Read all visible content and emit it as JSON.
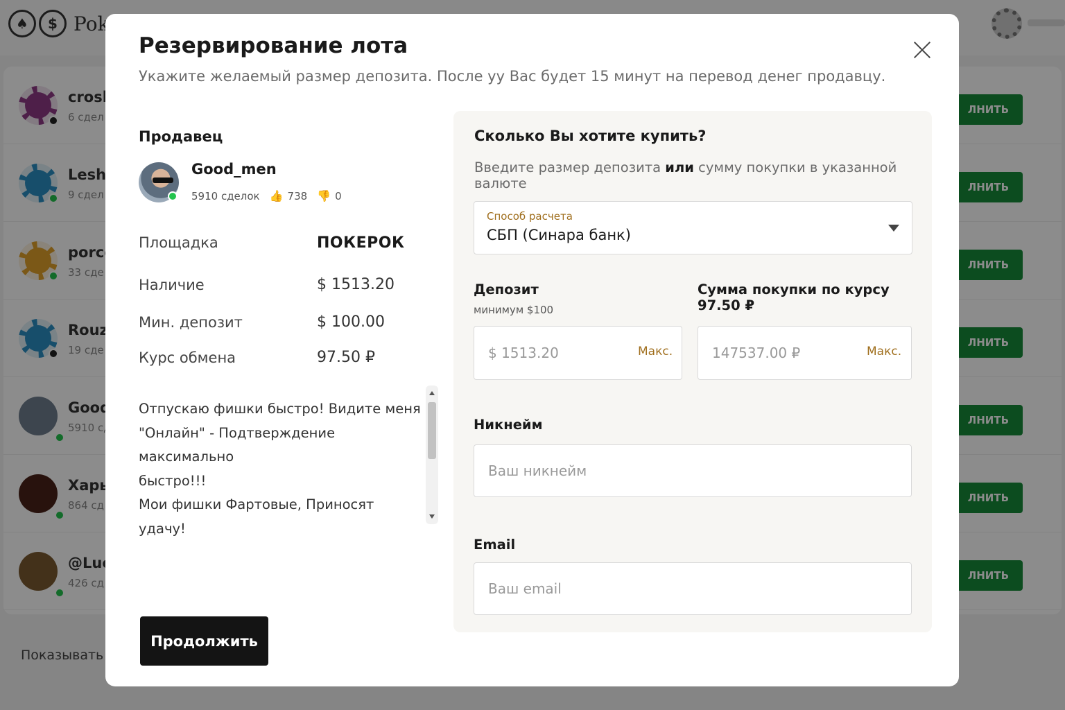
{
  "background": {
    "brand": "Pok",
    "logo_symbol": "$",
    "rows": [
      {
        "name": "crosb",
        "sub": "6 сдел",
        "avatar_color": "#8e3a86",
        "status_color": "#222",
        "button": "ЛНИТЬ"
      },
      {
        "name": "Leshi",
        "sub": "9 сдел",
        "avatar_color": "#2a8fc4",
        "status_color": "#23c44e",
        "button": "ЛНИТЬ"
      },
      {
        "name": "porce",
        "sub": "33 сде",
        "avatar_color": "#e0a12a",
        "status_color": "#23c44e",
        "button": "ЛНИТЬ"
      },
      {
        "name": "Rouzl",
        "sub": "19 сде",
        "avatar_color": "#2a8fc4",
        "status_color": "#222",
        "button": "ЛНИТЬ"
      },
      {
        "name": "Good",
        "sub": "5910 сд",
        "avatar_color": "#6f7f8e",
        "status_color": "#23c44e",
        "button": "ЛНИТЬ"
      },
      {
        "name": "Хары",
        "sub": "864 сд",
        "avatar_color": "#4a2218",
        "status_color": "#23c44e",
        "button": "ЛНИТЬ"
      },
      {
        "name": "@Luc",
        "sub": "426 сд",
        "avatar_color": "#7a5a30",
        "status_color": "#23c44e",
        "button": "ЛНИТЬ"
      }
    ],
    "show_label": "Показывать"
  },
  "modal": {
    "title": "Резервирование лота",
    "subtitle": "Укажите желаемый размер депозита.  После уу Вас будет 15 минут на перевод денег продавцу.",
    "seller_heading": "Продавец",
    "seller": {
      "name": "Good_men",
      "deals": "5910 сделок",
      "likes": "738",
      "dislikes": "0",
      "online": true
    },
    "info": [
      {
        "label": "Площадка",
        "value": "ПОКЕРОК"
      },
      {
        "label": "Наличие",
        "value": "$ 1513.20"
      },
      {
        "label": "Мин. депозит",
        "value": "$ 100.00"
      },
      {
        "label": "Курс обмена",
        "value": "97.50 ₽"
      }
    ],
    "description": "Отпускаю фишки быстро! Видите меня\n\"Онлайн\" - Подтверждение максимально\nбыстро!!!\nМои фишки Фартовые, Приносят удачу!\nЗаряжены затаскивать флипы в твою\nпользу!!!",
    "continue_label": "Продолжить",
    "form": {
      "title": "Сколько Вы хотите купить?",
      "hint_before": "Введите размер депозита",
      "hint_or": "или",
      "hint_after": "сумму покупки в указанной валюте",
      "payment": {
        "caption": "Способ расчета",
        "value": "СБП (Синара банк)"
      },
      "deposit": {
        "label": "Депозит",
        "note": "минимум $100",
        "placeholder": "$ 1513.20",
        "max_label": "Макс."
      },
      "purchase": {
        "label": "Сумма покупки по курсу 97.50 ₽",
        "placeholder": "147537.00 ₽",
        "max_label": "Макс."
      },
      "nickname": {
        "label": "Никнейм",
        "placeholder": "Ваш никнейм"
      },
      "email": {
        "label": "Email",
        "placeholder": "Ваш email"
      }
    }
  }
}
